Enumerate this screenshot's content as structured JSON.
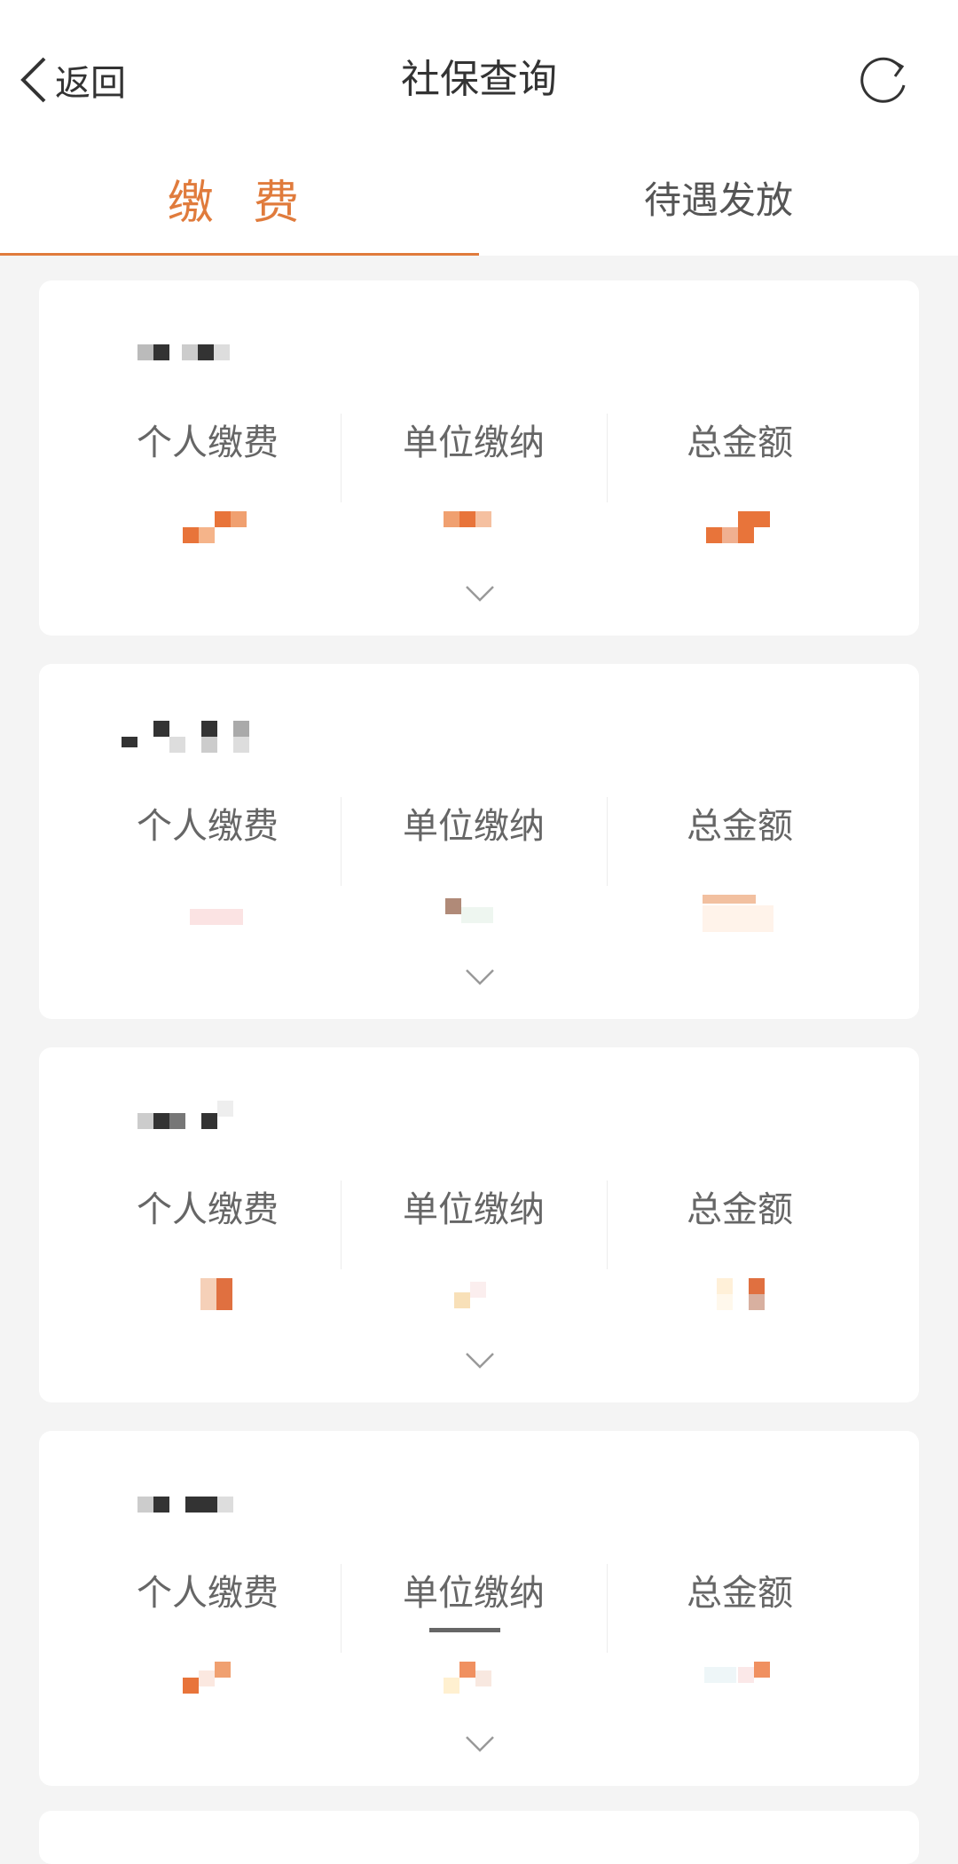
{
  "header": {
    "back_label": "返回",
    "title": "社保查询",
    "refresh_icon": "refresh-icon",
    "back_icon": "chevron-left-icon"
  },
  "tabs": [
    {
      "label": "缴 费",
      "active": true
    },
    {
      "label": "待遇发放",
      "active": false
    }
  ],
  "colors": {
    "accent": "#e07b3c",
    "background": "#f4f4f4",
    "card": "#ffffff",
    "label": "#666666"
  },
  "cards": [
    {
      "labels": [
        "个人缴费",
        "单位缴纳",
        "总金额"
      ],
      "expand_icon": "chevron-down-icon"
    },
    {
      "labels": [
        "个人缴费",
        "单位缴纳",
        "总金额"
      ],
      "expand_icon": "chevron-down-icon"
    },
    {
      "labels": [
        "个人缴费",
        "单位缴纳",
        "总金额"
      ],
      "expand_icon": "chevron-down-icon"
    },
    {
      "labels": [
        "个人缴费",
        "单位缴纳",
        "总金额"
      ],
      "expand_icon": "chevron-down-icon"
    }
  ]
}
